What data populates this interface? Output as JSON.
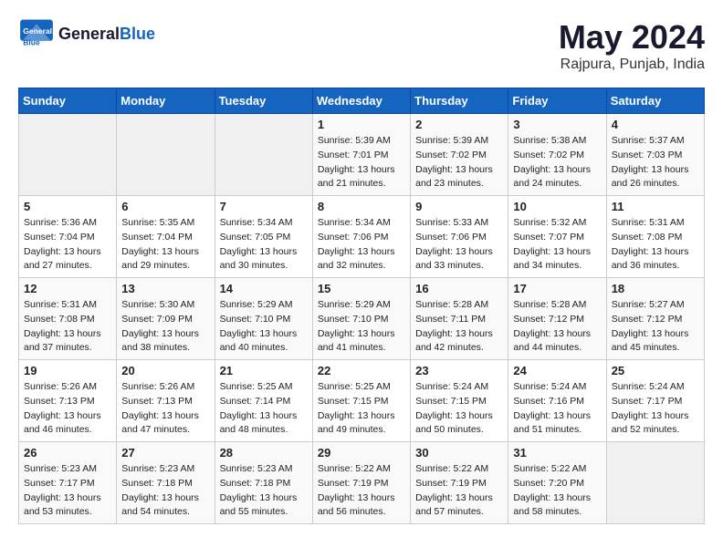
{
  "header": {
    "logo_general": "General",
    "logo_blue": "Blue",
    "month_year": "May 2024",
    "location": "Rajpura, Punjab, India"
  },
  "weekdays": [
    "Sunday",
    "Monday",
    "Tuesday",
    "Wednesday",
    "Thursday",
    "Friday",
    "Saturday"
  ],
  "weeks": [
    [
      {
        "day": "",
        "sunrise": "",
        "sunset": "",
        "daylight": ""
      },
      {
        "day": "",
        "sunrise": "",
        "sunset": "",
        "daylight": ""
      },
      {
        "day": "",
        "sunrise": "",
        "sunset": "",
        "daylight": ""
      },
      {
        "day": "1",
        "sunrise": "Sunrise: 5:39 AM",
        "sunset": "Sunset: 7:01 PM",
        "daylight": "Daylight: 13 hours and 21 minutes."
      },
      {
        "day": "2",
        "sunrise": "Sunrise: 5:39 AM",
        "sunset": "Sunset: 7:02 PM",
        "daylight": "Daylight: 13 hours and 23 minutes."
      },
      {
        "day": "3",
        "sunrise": "Sunrise: 5:38 AM",
        "sunset": "Sunset: 7:02 PM",
        "daylight": "Daylight: 13 hours and 24 minutes."
      },
      {
        "day": "4",
        "sunrise": "Sunrise: 5:37 AM",
        "sunset": "Sunset: 7:03 PM",
        "daylight": "Daylight: 13 hours and 26 minutes."
      }
    ],
    [
      {
        "day": "5",
        "sunrise": "Sunrise: 5:36 AM",
        "sunset": "Sunset: 7:04 PM",
        "daylight": "Daylight: 13 hours and 27 minutes."
      },
      {
        "day": "6",
        "sunrise": "Sunrise: 5:35 AM",
        "sunset": "Sunset: 7:04 PM",
        "daylight": "Daylight: 13 hours and 29 minutes."
      },
      {
        "day": "7",
        "sunrise": "Sunrise: 5:34 AM",
        "sunset": "Sunset: 7:05 PM",
        "daylight": "Daylight: 13 hours and 30 minutes."
      },
      {
        "day": "8",
        "sunrise": "Sunrise: 5:34 AM",
        "sunset": "Sunset: 7:06 PM",
        "daylight": "Daylight: 13 hours and 32 minutes."
      },
      {
        "day": "9",
        "sunrise": "Sunrise: 5:33 AM",
        "sunset": "Sunset: 7:06 PM",
        "daylight": "Daylight: 13 hours and 33 minutes."
      },
      {
        "day": "10",
        "sunrise": "Sunrise: 5:32 AM",
        "sunset": "Sunset: 7:07 PM",
        "daylight": "Daylight: 13 hours and 34 minutes."
      },
      {
        "day": "11",
        "sunrise": "Sunrise: 5:31 AM",
        "sunset": "Sunset: 7:08 PM",
        "daylight": "Daylight: 13 hours and 36 minutes."
      }
    ],
    [
      {
        "day": "12",
        "sunrise": "Sunrise: 5:31 AM",
        "sunset": "Sunset: 7:08 PM",
        "daylight": "Daylight: 13 hours and 37 minutes."
      },
      {
        "day": "13",
        "sunrise": "Sunrise: 5:30 AM",
        "sunset": "Sunset: 7:09 PM",
        "daylight": "Daylight: 13 hours and 38 minutes."
      },
      {
        "day": "14",
        "sunrise": "Sunrise: 5:29 AM",
        "sunset": "Sunset: 7:10 PM",
        "daylight": "Daylight: 13 hours and 40 minutes."
      },
      {
        "day": "15",
        "sunrise": "Sunrise: 5:29 AM",
        "sunset": "Sunset: 7:10 PM",
        "daylight": "Daylight: 13 hours and 41 minutes."
      },
      {
        "day": "16",
        "sunrise": "Sunrise: 5:28 AM",
        "sunset": "Sunset: 7:11 PM",
        "daylight": "Daylight: 13 hours and 42 minutes."
      },
      {
        "day": "17",
        "sunrise": "Sunrise: 5:28 AM",
        "sunset": "Sunset: 7:12 PM",
        "daylight": "Daylight: 13 hours and 44 minutes."
      },
      {
        "day": "18",
        "sunrise": "Sunrise: 5:27 AM",
        "sunset": "Sunset: 7:12 PM",
        "daylight": "Daylight: 13 hours and 45 minutes."
      }
    ],
    [
      {
        "day": "19",
        "sunrise": "Sunrise: 5:26 AM",
        "sunset": "Sunset: 7:13 PM",
        "daylight": "Daylight: 13 hours and 46 minutes."
      },
      {
        "day": "20",
        "sunrise": "Sunrise: 5:26 AM",
        "sunset": "Sunset: 7:13 PM",
        "daylight": "Daylight: 13 hours and 47 minutes."
      },
      {
        "day": "21",
        "sunrise": "Sunrise: 5:25 AM",
        "sunset": "Sunset: 7:14 PM",
        "daylight": "Daylight: 13 hours and 48 minutes."
      },
      {
        "day": "22",
        "sunrise": "Sunrise: 5:25 AM",
        "sunset": "Sunset: 7:15 PM",
        "daylight": "Daylight: 13 hours and 49 minutes."
      },
      {
        "day": "23",
        "sunrise": "Sunrise: 5:24 AM",
        "sunset": "Sunset: 7:15 PM",
        "daylight": "Daylight: 13 hours and 50 minutes."
      },
      {
        "day": "24",
        "sunrise": "Sunrise: 5:24 AM",
        "sunset": "Sunset: 7:16 PM",
        "daylight": "Daylight: 13 hours and 51 minutes."
      },
      {
        "day": "25",
        "sunrise": "Sunrise: 5:24 AM",
        "sunset": "Sunset: 7:17 PM",
        "daylight": "Daylight: 13 hours and 52 minutes."
      }
    ],
    [
      {
        "day": "26",
        "sunrise": "Sunrise: 5:23 AM",
        "sunset": "Sunset: 7:17 PM",
        "daylight": "Daylight: 13 hours and 53 minutes."
      },
      {
        "day": "27",
        "sunrise": "Sunrise: 5:23 AM",
        "sunset": "Sunset: 7:18 PM",
        "daylight": "Daylight: 13 hours and 54 minutes."
      },
      {
        "day": "28",
        "sunrise": "Sunrise: 5:23 AM",
        "sunset": "Sunset: 7:18 PM",
        "daylight": "Daylight: 13 hours and 55 minutes."
      },
      {
        "day": "29",
        "sunrise": "Sunrise: 5:22 AM",
        "sunset": "Sunset: 7:19 PM",
        "daylight": "Daylight: 13 hours and 56 minutes."
      },
      {
        "day": "30",
        "sunrise": "Sunrise: 5:22 AM",
        "sunset": "Sunset: 7:19 PM",
        "daylight": "Daylight: 13 hours and 57 minutes."
      },
      {
        "day": "31",
        "sunrise": "Sunrise: 5:22 AM",
        "sunset": "Sunset: 7:20 PM",
        "daylight": "Daylight: 13 hours and 58 minutes."
      },
      {
        "day": "",
        "sunrise": "",
        "sunset": "",
        "daylight": ""
      }
    ]
  ]
}
